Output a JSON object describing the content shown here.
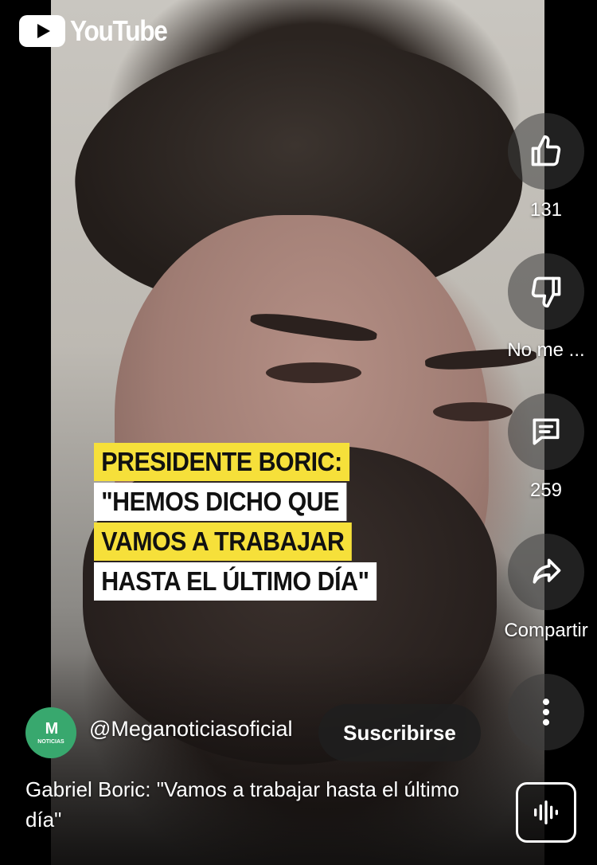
{
  "app": {
    "logo_text": "YouTube"
  },
  "video": {
    "captions": [
      {
        "text": "PRESIDENTE BORIC:",
        "style": "yellow"
      },
      {
        "text": "\"HEMOS DICHO QUE",
        "style": "white"
      },
      {
        "text": "VAMOS A TRABAJAR",
        "style": "yellow"
      },
      {
        "text": "HASTA EL ÚLTIMO DÍA\"",
        "style": "white"
      }
    ]
  },
  "actions": {
    "like": {
      "icon": "thumbs-up-icon",
      "label": "131"
    },
    "dislike": {
      "icon": "thumbs-down-icon",
      "label": "No me ..."
    },
    "comments": {
      "icon": "comment-icon",
      "label": "259"
    },
    "share": {
      "icon": "share-icon",
      "label": "Compartir"
    },
    "more": {
      "icon": "more-vertical-icon"
    }
  },
  "channel": {
    "avatar_mark": "M",
    "avatar_sub": "NOTICIAS",
    "name": "@Meganoticiasoficial",
    "subscribe_label": "Suscribirse"
  },
  "title": "Gabriel Boric: \"Vamos a trabajar hasta el último día\"",
  "sound": {
    "icon": "audio-wave-icon"
  },
  "colors": {
    "caption_yellow": "#f6e03a",
    "caption_white": "#ffffff",
    "avatar_green": "#38a86e"
  }
}
